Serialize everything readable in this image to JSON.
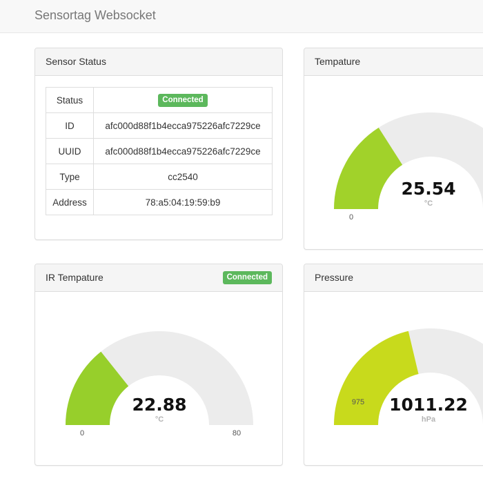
{
  "navbar": {
    "title": "Sensortag Websocket"
  },
  "sensor_status": {
    "title": "Sensor Status",
    "rows": [
      {
        "key": "Status",
        "value": "Connected",
        "badge": true
      },
      {
        "key": "ID",
        "value": "afc000d88f1b4ecca975226afc7229ce"
      },
      {
        "key": "UUID",
        "value": "afc000d88f1b4ecca975226afc7229ce"
      },
      {
        "key": "Type",
        "value": "cc2540"
      },
      {
        "key": "Address",
        "value": "78:a5:04:19:59:b9"
      }
    ]
  },
  "temperature": {
    "title": "Tempature",
    "gauge": {
      "value": 25.54,
      "value_text": "25.54",
      "unit": "°C",
      "min": 0,
      "min_label": "0",
      "max": 80,
      "fill_color": "#a1d22a",
      "track_color": "#ececec"
    }
  },
  "ir_temperature": {
    "title": "IR Tempature",
    "badge": "Connected",
    "gauge": {
      "value": 22.88,
      "value_text": "22.88",
      "unit": "°C",
      "min": 0,
      "min_label": "0",
      "max": 80,
      "max_label": "80",
      "fill_color": "#97cf2b",
      "track_color": "#ececec"
    }
  },
  "pressure": {
    "title": "Pressure",
    "gauge": {
      "value": 1011.22,
      "value_text": "1011.22",
      "unit": "hPa",
      "min": 975,
      "min_label": "975",
      "max": 1060,
      "fill_color": "#c8da1c",
      "track_color": "#ececec"
    }
  },
  "colors": {
    "success": "#5cb85c",
    "panel_heading_bg": "#f5f5f5",
    "border": "#dddddd"
  }
}
